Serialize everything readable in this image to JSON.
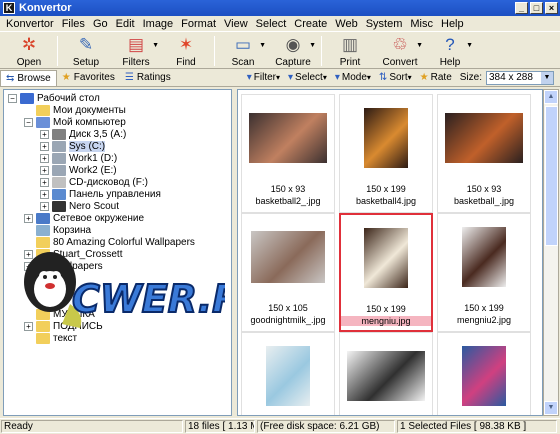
{
  "window": {
    "title": "Konvertor",
    "min": "_",
    "max": "□",
    "close": "×"
  },
  "menu": [
    "Konvertor",
    "Files",
    "Go",
    "Edit",
    "Image",
    "Format",
    "View",
    "Select",
    "Create",
    "Web",
    "System",
    "Misc",
    "Help"
  ],
  "toolbar": [
    {
      "label": "Open",
      "icon": "open-icon",
      "glyph": "✲",
      "color": "#d9452b"
    },
    {
      "label": "Setup",
      "icon": "setup-tools-icon",
      "glyph": "✎",
      "color": "#3a6ab8"
    },
    {
      "label": "Filters",
      "icon": "filters-icon",
      "glyph": "▤",
      "color": "#d04646"
    },
    {
      "label": "Find",
      "icon": "find-icon",
      "glyph": "✶",
      "color": "#e0462a"
    },
    {
      "label": "Scan",
      "icon": "scanner-icon",
      "glyph": "▭",
      "color": "#3a6ab8"
    },
    {
      "label": "Capture",
      "icon": "camera-icon",
      "glyph": "◉",
      "color": "#555"
    },
    {
      "label": "Print",
      "icon": "printer-icon",
      "glyph": "▥",
      "color": "#666"
    },
    {
      "label": "Convert",
      "icon": "convert-icon",
      "glyph": "♲",
      "color": "#c23c3c"
    },
    {
      "label": "Help",
      "icon": "help-icon",
      "glyph": "?",
      "color": "#2558b8"
    }
  ],
  "viewbar": {
    "tabs": [
      {
        "label": "Browse",
        "icon": "browse-icon"
      },
      {
        "label": "Favorites",
        "icon": "star-icon"
      },
      {
        "label": "Ratings",
        "icon": "ratings-icon"
      }
    ],
    "buttons": [
      {
        "label": "Filter",
        "icon": "filter-icon"
      },
      {
        "label": "Select",
        "icon": "select-icon"
      },
      {
        "label": "Mode",
        "icon": "mode-icon"
      },
      {
        "label": "Sort",
        "icon": "sort-icon"
      },
      {
        "label": "Rate",
        "icon": "rate-icon"
      }
    ],
    "size_label": "Size:",
    "size_value": "384 x 288"
  },
  "tree": [
    {
      "label": "Рабочий стол",
      "pm": "−",
      "level": 0,
      "icon": "desktop-icon",
      "color": "#3a6ad0"
    },
    {
      "label": "Мои документы",
      "pm": "",
      "level": 1,
      "icon": "folder-icon",
      "color": "#f2cf5b"
    },
    {
      "label": "Мой компьютер",
      "pm": "−",
      "level": 1,
      "icon": "computer-icon",
      "color": "#6a8fd8"
    },
    {
      "label": "Диск 3,5 (A:)",
      "pm": "+",
      "level": 2,
      "icon": "floppy-icon",
      "color": "#808080"
    },
    {
      "label": "Sys (C:)",
      "pm": "+",
      "level": 2,
      "icon": "drive-icon",
      "color": "#9aa6b4",
      "selected": true
    },
    {
      "label": "Work1 (D:)",
      "pm": "+",
      "level": 2,
      "icon": "drive-icon",
      "color": "#9aa6b4"
    },
    {
      "label": "Work2 (E:)",
      "pm": "+",
      "level": 2,
      "icon": "drive-icon",
      "color": "#9aa6b4"
    },
    {
      "label": "CD-дисковод (F:)",
      "pm": "+",
      "level": 2,
      "icon": "cd-icon",
      "color": "#c0c0c0"
    },
    {
      "label": "Панель управления",
      "pm": "+",
      "level": 2,
      "icon": "control-panel-icon",
      "color": "#5a8ad0"
    },
    {
      "label": "Nero Scout",
      "pm": "+",
      "level": 2,
      "icon": "nero-icon",
      "color": "#333"
    },
    {
      "label": "Сетевое окружение",
      "pm": "+",
      "level": 1,
      "icon": "network-icon",
      "color": "#4a7ac8"
    },
    {
      "label": "Корзина",
      "pm": "",
      "level": 1,
      "icon": "recycle-bin-icon",
      "color": "#8ab0d0"
    },
    {
      "label": "80 Amazing Colorful Wallpapers",
      "pm": "",
      "level": 1,
      "icon": "folder-icon",
      "color": "#f2cf5b"
    },
    {
      "label": "Stuart_Crossett",
      "pm": "+",
      "level": 1,
      "icon": "folder-icon",
      "color": "#f2cf5b"
    },
    {
      "label": "Wallpapers",
      "pm": "+",
      "level": 1,
      "icon": "folder-icon",
      "color": "#f2cf5b"
    },
    {
      "label": "",
      "pm": "",
      "level": 1,
      "icon": "folder-icon",
      "color": "#f2cf5b"
    },
    {
      "label": "",
      "pm": "",
      "level": 1,
      "icon": "folder-icon",
      "color": "#f2cf5b"
    },
    {
      "label": "",
      "pm": "",
      "level": 1,
      "icon": "folder-icon",
      "color": "#f2cf5b"
    },
    {
      "label": "МУЗЫКА",
      "pm": "",
      "level": 1,
      "icon": "folder-icon",
      "color": "#f2cf5b"
    },
    {
      "label": "ПОДПИСЬ",
      "pm": "+",
      "level": 1,
      "icon": "folder-icon",
      "color": "#f2cf5b"
    },
    {
      "label": "текст",
      "pm": "",
      "level": 1,
      "icon": "folder-icon",
      "color": "#f2cf5b"
    }
  ],
  "thumbnails": [
    {
      "dims": "150 x 93",
      "name": "basketball2_.jpg",
      "bg": "#3b3030",
      "fg": "#c08060",
      "ratio": "landscape"
    },
    {
      "dims": "150 x 199",
      "name": "basketball4.jpg",
      "bg": "#2c1a14",
      "fg": "#d98a30",
      "ratio": "portrait"
    },
    {
      "dims": "150 x 93",
      "name": "basketball_.jpg",
      "bg": "#2a2020",
      "fg": "#c0602a",
      "ratio": "landscape"
    },
    {
      "dims": "150 x 105",
      "name": "goodnightmilk_.jpg",
      "bg": "#c9c6c4",
      "fg": "#8a6a5a",
      "ratio": "landscape2"
    },
    {
      "dims": "150 x 199",
      "name": "mengniu.jpg",
      "bg": "#3a2418",
      "fg": "#f0e8d8",
      "ratio": "portrait",
      "selected": true
    },
    {
      "dims": "150 x 199",
      "name": "mengniu2.jpg",
      "bg": "#eeeeee",
      "fg": "#4a2a20",
      "ratio": "portrait"
    },
    {
      "dims": "",
      "name": "",
      "bg": "#e8eef0",
      "fg": "#9ac8e0",
      "ratio": "portrait"
    },
    {
      "dims": "",
      "name": "",
      "bg": "#f4f4f4",
      "fg": "#303030",
      "ratio": "landscape"
    },
    {
      "dims": "",
      "name": "",
      "bg": "#2a5aa0",
      "fg": "#d04080",
      "ratio": "portrait"
    }
  ],
  "logo_text": "CWER.RU",
  "status": {
    "ready": "Ready",
    "files": "18 files [ 1.13 MB ]",
    "free": "(Free disk space: 6.21 GB)",
    "selected": "1 Selected Files [ 98.38 KB ]"
  }
}
